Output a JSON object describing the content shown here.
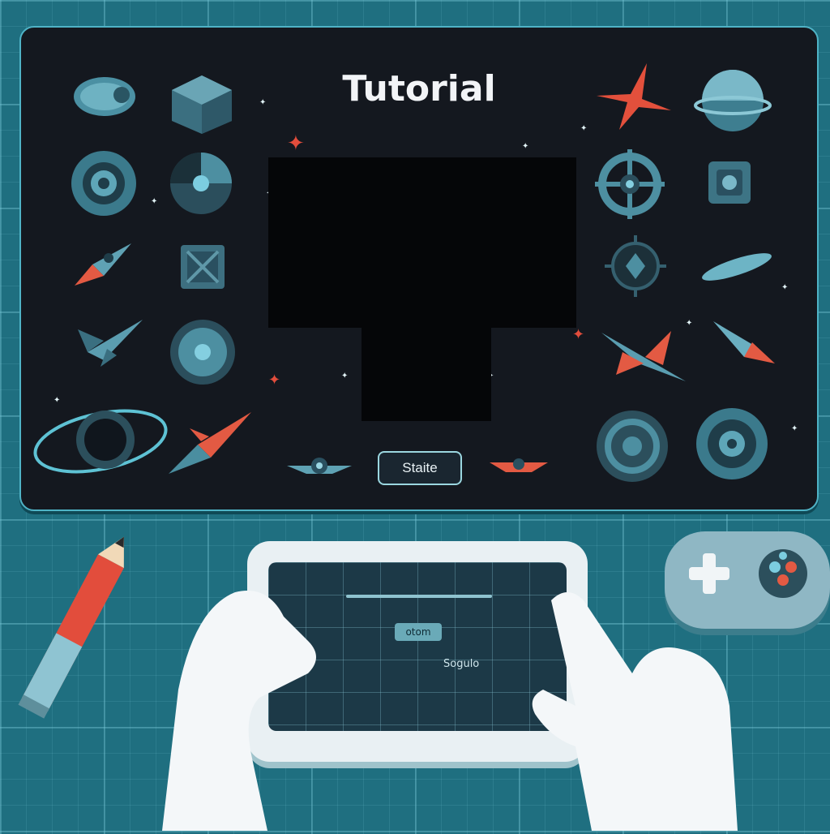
{
  "screen": {
    "title": "Tutorial",
    "start_button": "Staite"
  },
  "tablet": {
    "button_label": "otom",
    "text": "Sogulo"
  },
  "colors": {
    "background": "#1f6f80",
    "screen_bg": "#14181f",
    "accent_cyan": "#4fb3c6",
    "accent_red": "#e24d3c"
  },
  "icons": [
    "pod-ship-icon",
    "cube-icon",
    "gear-wheel-icon",
    "pie-disc-icon",
    "rocket-icon",
    "crate-icon",
    "fighter-jet-icon",
    "round-shield-icon",
    "ringed-planet-icon",
    "red-rocket-icon",
    "small-ship-icon",
    "red-star-icon",
    "planet-icon",
    "crosshair-gear-icon",
    "square-badge-icon",
    "spiked-orb-icon",
    "saucer-icon",
    "red-jet-icon",
    "side-rocket-icon",
    "gear-icon-a",
    "gear-icon-b"
  ]
}
